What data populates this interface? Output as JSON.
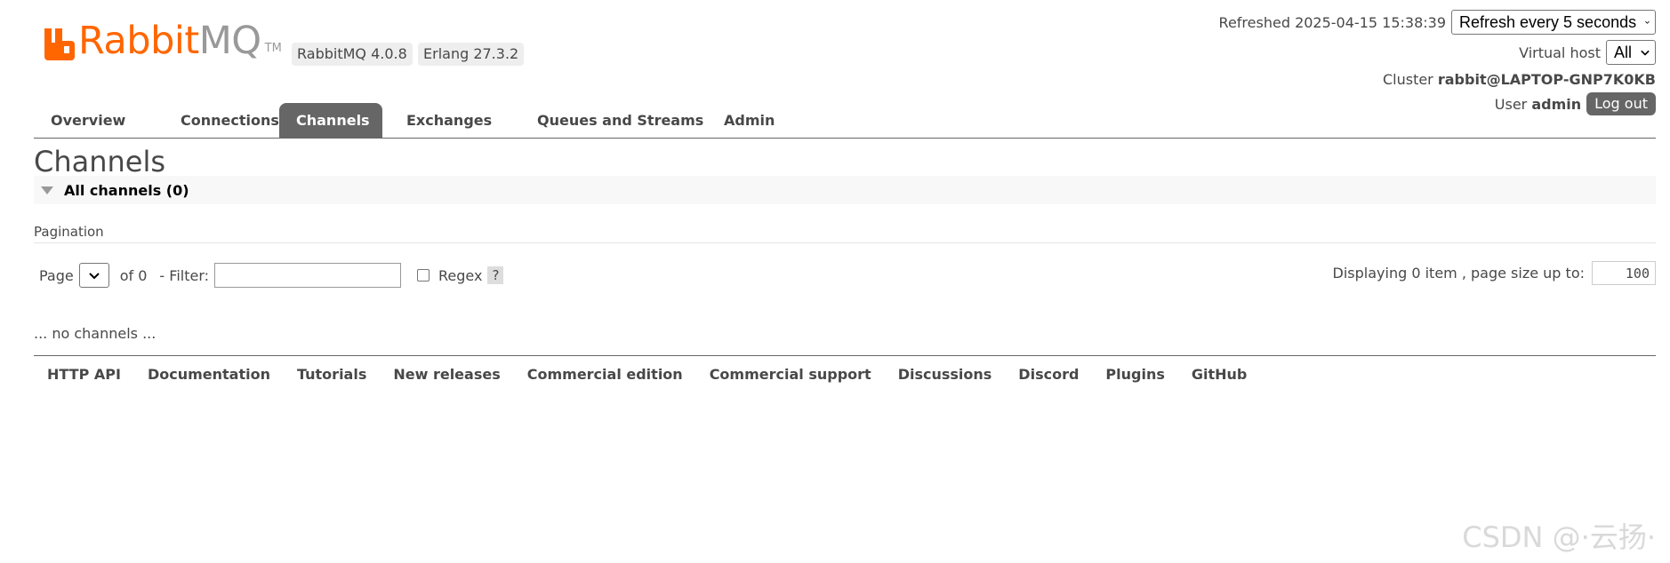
{
  "logo": {
    "rabbit": "Rabbit",
    "mq": "MQ",
    "tm": "TM"
  },
  "versions": {
    "rabbitmq": "RabbitMQ 4.0.8",
    "erlang": "Erlang 27.3.2"
  },
  "header": {
    "refreshed_label": "Refreshed",
    "refreshed_time": "2025-04-15 15:38:39",
    "refresh_select_value": "Refresh every 5 seconds",
    "vhost_label": "Virtual host",
    "vhost_value": "All",
    "cluster_label": "Cluster",
    "cluster_value": "rabbit@LAPTOP-GNP7K0KB",
    "user_label": "User",
    "user_value": "admin",
    "logout_label": "Log out"
  },
  "tabs": [
    {
      "label": "Overview",
      "active": false
    },
    {
      "label": "Connections",
      "active": false
    },
    {
      "label": "Channels",
      "active": true
    },
    {
      "label": "Exchanges",
      "active": false
    },
    {
      "label": "Queues and Streams",
      "active": false
    },
    {
      "label": "Admin",
      "active": false
    }
  ],
  "page": {
    "title": "Channels",
    "section_label": "All channels (0)",
    "pagination_label": "Pagination",
    "page_label": "Page",
    "of_label": "of 0",
    "filter_label": "- Filter:",
    "filter_value": "",
    "regex_label": "Regex",
    "help_label": "?",
    "displaying_label": "Displaying 0 item , page size up to:",
    "page_size": "100",
    "empty_message": "... no channels ..."
  },
  "footer": [
    "HTTP API",
    "Documentation",
    "Tutorials",
    "New releases",
    "Commercial edition",
    "Commercial support",
    "Discussions",
    "Discord",
    "Plugins",
    "GitHub"
  ],
  "watermark": "CSDN @·云扬·",
  "colors": {
    "brand_orange": "#ff6600",
    "tab_active": "#666666",
    "text": "#484848"
  }
}
